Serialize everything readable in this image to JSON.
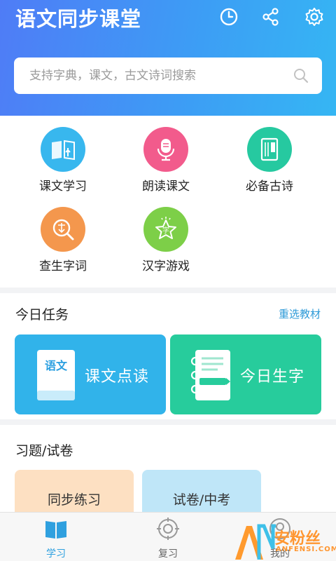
{
  "header": {
    "title": "语文同步课堂",
    "icons": [
      "clock-icon",
      "share-icon",
      "settings-icon"
    ]
  },
  "search": {
    "placeholder": "支持字典，课文，古文诗词搜索"
  },
  "features": [
    {
      "label": "课文学习",
      "icon": "book-touch-icon",
      "color": "#38b7ee"
    },
    {
      "label": "朗读课文",
      "icon": "microphone-icon",
      "color": "#f25b8c"
    },
    {
      "label": "必备古诗",
      "icon": "scroll-book-icon",
      "color": "#26c9a0"
    },
    {
      "label": "查生字词",
      "icon": "magnifier-character-icon",
      "color": "#f4974d"
    },
    {
      "label": "汉字游戏",
      "icon": "star-character-icon",
      "color": "#7dcf48"
    }
  ],
  "tasks": {
    "title": "今日任务",
    "reselect": "重选教材",
    "cards": [
      {
        "label": "课文点读",
        "book_text": "语文",
        "color": "#31b3ea"
      },
      {
        "label": "今日生字",
        "color": "#27cc9c"
      }
    ]
  },
  "exercises": {
    "title": "习题/试卷",
    "cards": [
      {
        "label": "同步练习",
        "color": "#fde0c2"
      },
      {
        "label": "试卷/中考",
        "color": "#bfe6f8"
      }
    ]
  },
  "tabbar": {
    "tabs": [
      {
        "label": "学习",
        "icon": "book-icon",
        "active": true
      },
      {
        "label": "复习",
        "icon": "target-icon",
        "active": false
      },
      {
        "label": "我的",
        "icon": "profile-icon",
        "active": false
      }
    ]
  },
  "watermark": {
    "text": "安粉丝",
    "sub": "ANFENSI.COM"
  },
  "colors": {
    "accent": "#2f9bd8",
    "header_start": "#4f7cf6",
    "header_end": "#35b6f3"
  }
}
